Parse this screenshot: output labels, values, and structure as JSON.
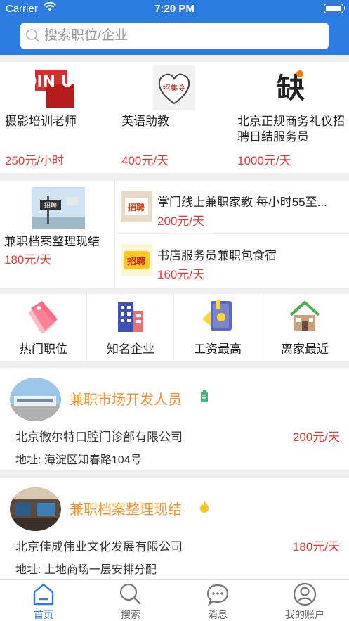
{
  "status_bar": {
    "carrier": "Carrier",
    "time": "7:20 PM"
  },
  "search": {
    "placeholder": "搜索职位/企业"
  },
  "featured": [
    {
      "title": "摄影培训老师",
      "price": "250元/小时",
      "thumb_text": "JOIN US"
    },
    {
      "title": "英语助教",
      "price": "400元/天",
      "thumb_text": "招集令"
    },
    {
      "title": "北京正规商务礼仪招聘日结服务员",
      "price": "1000元/天",
      "thumb_text": "缺"
    }
  ],
  "secondary": {
    "left": {
      "title": "兼职档案整理现结",
      "price": "180元/天",
      "thumb_text": "招聘"
    },
    "items": [
      {
        "title": "掌门线上兼职家教 每小时55至...",
        "price": "200元/天",
        "thumb_text": "招聘"
      },
      {
        "title": "书店服务员兼职包食宿",
        "price": "160元/天",
        "thumb_text": "招聘"
      }
    ]
  },
  "categories": [
    {
      "label": "热门职位",
      "icon": "tag-icon"
    },
    {
      "label": "知名企业",
      "icon": "building-icon"
    },
    {
      "label": "工资最高",
      "icon": "wallet-icon"
    },
    {
      "label": "离家最近",
      "icon": "house-icon"
    }
  ],
  "jobs": [
    {
      "name": "兼职市场开发人员",
      "company": "北京微尔特口腔门诊部有限公司",
      "salary": "200元/天",
      "address": "地址: 海淀区知春路104号",
      "badge": "battery-badge-icon"
    },
    {
      "name": "兼职档案整理现结",
      "company": "北京佳成伟业文化发展有限公司",
      "salary": "180元/天",
      "address": "地址: 上地商场一层安排分配",
      "badge": "flame-badge-icon"
    }
  ],
  "tabbar": [
    {
      "label": "首页",
      "icon": "home-icon",
      "active": true
    },
    {
      "label": "搜索",
      "icon": "search-icon",
      "active": false
    },
    {
      "label": "消息",
      "icon": "message-icon",
      "active": false
    },
    {
      "label": "我的账户",
      "icon": "account-icon",
      "active": false
    }
  ],
  "colors": {
    "brand": "#2c7be0",
    "price": "#e53935",
    "job_title": "#f2922f"
  }
}
